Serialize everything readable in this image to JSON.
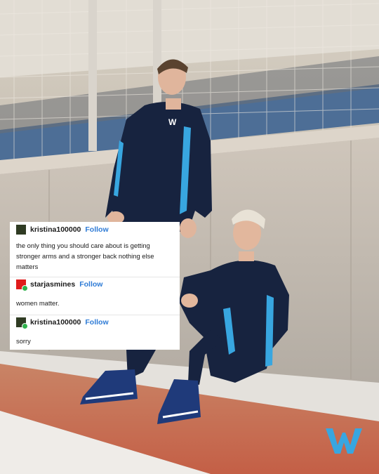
{
  "posts": [
    {
      "username": "kristina100000",
      "follow_label": "Follow",
      "text": "the only thing you should care about is getting stronger arms and a stronger back nothing else matters",
      "avatar_color": "#2f3b23"
    },
    {
      "username": "starjasmines",
      "follow_label": "Follow",
      "text": "women matter.",
      "avatar_color": "#e01b1b"
    },
    {
      "username": "kristina100000",
      "follow_label": "Follow",
      "text": "sorry",
      "avatar_color": "#2f3b23"
    }
  ],
  "colors": {
    "accent_link": "#2e7bd6",
    "brand_blue": "#38a6e0",
    "suit_navy": "#17233f"
  },
  "icons": {
    "brand_logo": "williams-w-logo"
  }
}
